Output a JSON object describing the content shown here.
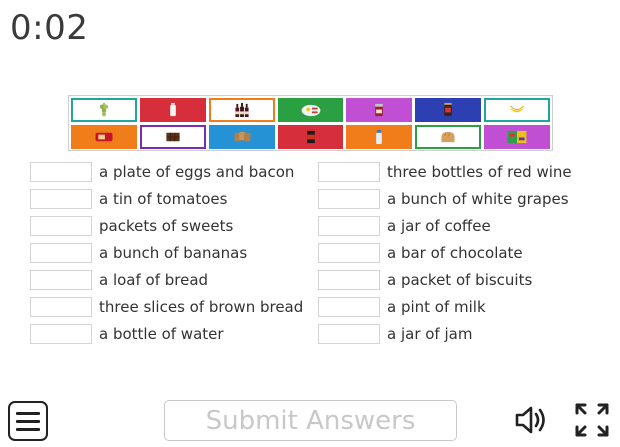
{
  "timer": "0:02",
  "tiles": {
    "row1": [
      {
        "icon": "grapes-icon",
        "bg": "#ffffff",
        "border": "#21a69b"
      },
      {
        "icon": "milk-bottle-icon",
        "bg": "#d62f3b",
        "border": "#d62f3b"
      },
      {
        "icon": "wine-bottles-icon",
        "bg": "#ffffff",
        "border": "#f07d1a"
      },
      {
        "icon": "eggs-bacon-plate-icon",
        "bg": "#2aa043",
        "border": "#2aa043"
      },
      {
        "icon": "jam-jar-icon",
        "bg": "#c14fd3",
        "border": "#c14fd3"
      },
      {
        "icon": "coffee-jar-icon",
        "bg": "#2c3fb3",
        "border": "#2c3fb3"
      },
      {
        "icon": "bananas-icon",
        "bg": "#ffffff",
        "border": "#21a69b"
      }
    ],
    "row2": [
      {
        "icon": "biscuits-packet-icon",
        "bg": "#f07d1a",
        "border": "#f07d1a"
      },
      {
        "icon": "chocolate-bar-icon",
        "bg": "#ffffff",
        "border": "#7a2cb3"
      },
      {
        "icon": "brown-bread-slices-icon",
        "bg": "#2592d6",
        "border": "#2592d6"
      },
      {
        "icon": "tomato-tin-icon",
        "bg": "#d62f3b",
        "border": "#d62f3b"
      },
      {
        "icon": "water-bottle-icon",
        "bg": "#f07d1a",
        "border": "#f07d1a"
      },
      {
        "icon": "bread-loaf-icon",
        "bg": "#ffffff",
        "border": "#2aa043"
      },
      {
        "icon": "sweets-packets-icon",
        "bg": "#c14fd3",
        "border": "#c14fd3"
      }
    ]
  },
  "left_items": [
    "a plate of eggs and bacon",
    "a tin of tomatoes",
    "packets of sweets",
    "a bunch of bananas",
    "a loaf of bread",
    "three slices of brown bread",
    "a bottle of water"
  ],
  "right_items": [
    "three bottles of red wine",
    "a bunch of white grapes",
    "a jar of coffee",
    "a bar of chocolate",
    "a packet of biscuits",
    "a pint of milk",
    "a jar of jam"
  ],
  "controls": {
    "menu_icon": "hamburger-menu-icon",
    "submit_label": "Submit Answers",
    "sound_icon": "speaker-icon",
    "fullscreen_icon": "fullscreen-icon"
  }
}
